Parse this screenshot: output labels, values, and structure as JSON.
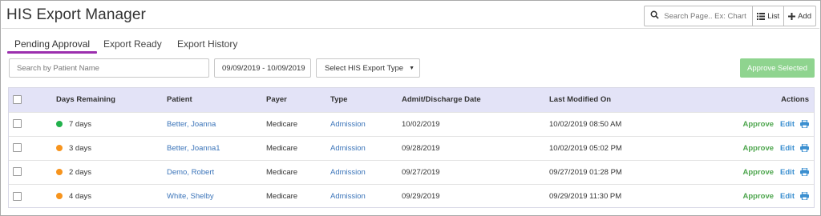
{
  "header": {
    "title": "HIS Export Manager",
    "search_placeholder": "Search Page.. Ex: Chart",
    "list_label": "List",
    "add_label": "Add"
  },
  "tabs": [
    {
      "label": "Pending Approval",
      "active": true
    },
    {
      "label": "Export Ready",
      "active": false
    },
    {
      "label": "Export History",
      "active": false
    }
  ],
  "filters": {
    "patient_placeholder": "Search by Patient Name",
    "date_range_value": "09/09/2019 - 10/09/2019",
    "export_type_label": "Select HIS Export Type",
    "approve_selected_label": "Approve Selected"
  },
  "table": {
    "columns": [
      "Days Remaining",
      "Patient",
      "Payer",
      "Type",
      "Admit/Discharge Date",
      "Last Modified On",
      "Actions"
    ],
    "rows": [
      {
        "status_color": "#22b14c",
        "days": "7 days",
        "patient": "Better, Joanna",
        "payer": "Medicare",
        "type": "Admission",
        "date": "10/02/2019",
        "modified": "10/02/2019 08:50 AM"
      },
      {
        "status_color": "#f7941d",
        "days": "3 days",
        "patient": "Better, Joanna1",
        "payer": "Medicare",
        "type": "Admission",
        "date": "09/28/2019",
        "modified": "10/02/2019 05:02 PM"
      },
      {
        "status_color": "#f7941d",
        "days": "2 days",
        "patient": "Demo, Robert",
        "payer": "Medicare",
        "type": "Admission",
        "date": "09/27/2019",
        "modified": "09/27/2019 01:28 PM"
      },
      {
        "status_color": "#f7941d",
        "days": "4 days",
        "patient": "White, Shelby",
        "payer": "Medicare",
        "type": "Admission",
        "date": "09/29/2019",
        "modified": "09/29/2019 11:30 PM"
      }
    ],
    "actions": {
      "approve": "Approve",
      "edit": "Edit"
    }
  },
  "icons": {
    "search": "search-icon",
    "list": "list-icon",
    "add": "plus-icon",
    "print": "print-icon",
    "caret": "caret-down-icon"
  },
  "colors": {
    "accent_tab": "#9b2fae",
    "approve_green": "#4ea64e",
    "link_blue": "#3b74b9",
    "header_row": "#e3e3f7"
  }
}
